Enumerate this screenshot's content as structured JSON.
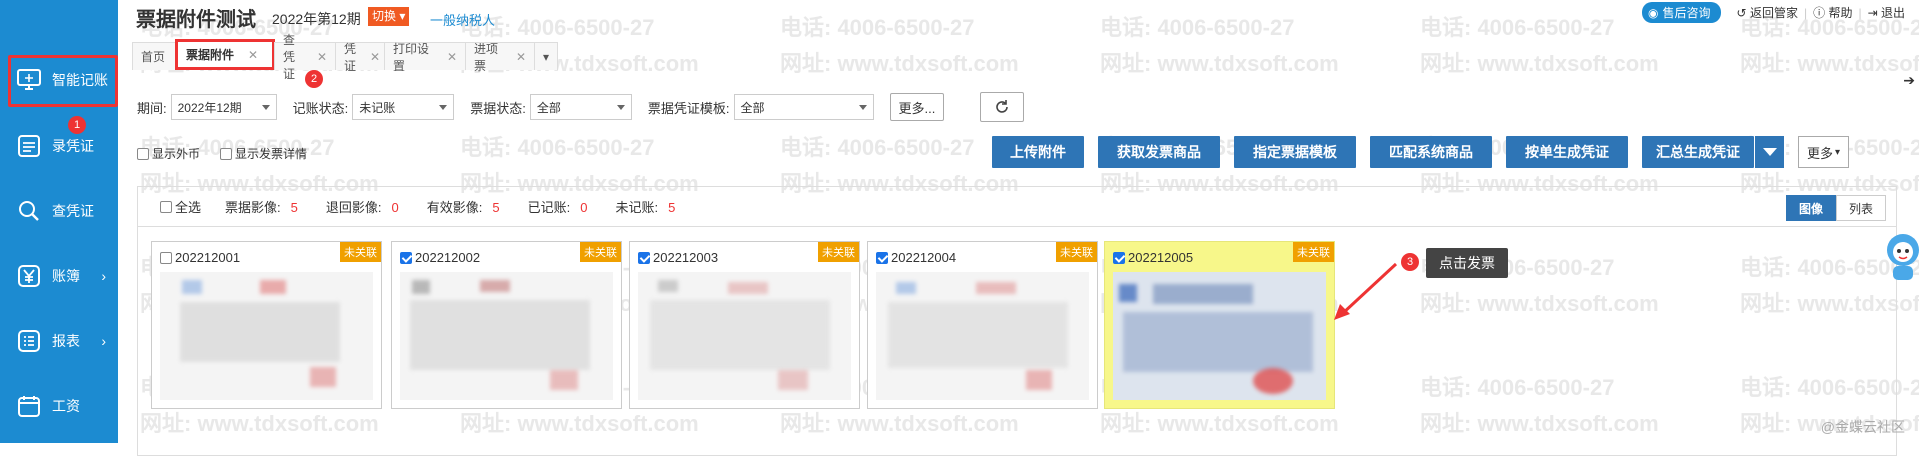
{
  "header": {
    "title": "票据附件测试",
    "period": "2022年第12期",
    "switch_label": "切换",
    "taxpayer": "一般纳税人"
  },
  "top_right": {
    "service": "售后咨询",
    "back": "返回管家",
    "help": "帮助",
    "logout": "退出"
  },
  "sidebar": {
    "items": [
      {
        "label": "智能记账",
        "icon": "monitor-ledger-icon"
      },
      {
        "label": "录凭证",
        "icon": "voucher-entry-icon"
      },
      {
        "label": "查凭证",
        "icon": "search-icon"
      },
      {
        "label": "账簿",
        "icon": "yen-icon"
      },
      {
        "label": "报表",
        "icon": "report-list-icon"
      },
      {
        "label": "工资",
        "icon": "salary-calendar-icon"
      }
    ],
    "badge": "1"
  },
  "tabs": [
    {
      "label": "首页",
      "closable": false
    },
    {
      "label": "票据附件",
      "closable": true,
      "active": true
    },
    {
      "label": "查凭证",
      "closable": true
    },
    {
      "label": "凭证",
      "closable": true
    },
    {
      "label": "打印设置",
      "closable": true
    },
    {
      "label": "进项票",
      "closable": true
    }
  ],
  "tab_badge": "2",
  "filters": {
    "period_label": "期间:",
    "period_value": "2022年12期",
    "status_label": "记账状态:",
    "status_value": "未记账",
    "bill_status_label": "票据状态:",
    "bill_status_value": "全部",
    "template_label": "票据凭证模板:",
    "template_value": "全部",
    "more": "更多..."
  },
  "options": {
    "foreign": "显示外币",
    "invoice_detail": "显示发票详情"
  },
  "actions": [
    "上传附件",
    "获取发票商品",
    "指定票据模板",
    "匹配系统商品",
    "按单生成凭证",
    "汇总生成凭证"
  ],
  "more_label": "更多",
  "stats": {
    "select_all": "全选",
    "image_label": "票据影像:",
    "image_count": "5",
    "returned_label": "退回影像:",
    "returned_count": "0",
    "valid_label": "有效影像:",
    "valid_count": "5",
    "booked_label": "已记账:",
    "booked_count": "0",
    "unbooked_label": "未记账:",
    "unbooked_count": "5"
  },
  "view_toggle": {
    "image": "图像",
    "list": "列表",
    "active": "图像"
  },
  "cards": [
    {
      "id": "202212001",
      "tag": "未关联",
      "checked": false,
      "selected": false
    },
    {
      "id": "202212002",
      "tag": "未关联",
      "checked": true,
      "selected": false
    },
    {
      "id": "202212003",
      "tag": "未关联",
      "checked": true,
      "selected": false
    },
    {
      "id": "202212004",
      "tag": "未关联",
      "checked": true,
      "selected": false
    },
    {
      "id": "202212005",
      "tag": "未关联",
      "checked": true,
      "selected": true
    }
  ],
  "annotation": {
    "badge": "3",
    "text": "点击发票"
  },
  "watermark": {
    "phone": "电话: 4006-6500-27",
    "site": "网址: www.tdxsoft.com"
  },
  "brand": "@金蝶云社区",
  "colors": {
    "sidebar": "#1c8bd1",
    "primary_button": "#2e75b6",
    "tag": "#f0a000",
    "highlight": "#e33333"
  }
}
